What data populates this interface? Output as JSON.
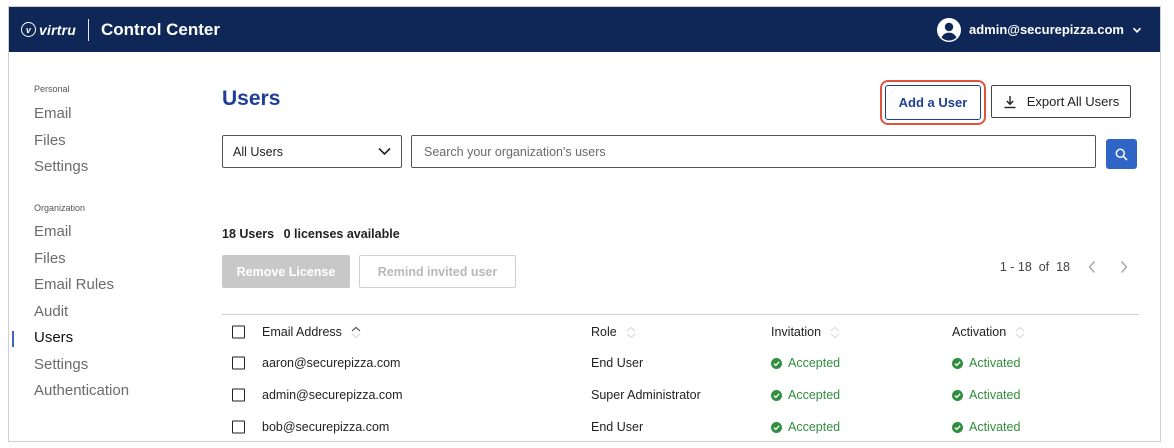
{
  "header": {
    "brand": "virtru",
    "brand_initial": "v",
    "title": "Control Center",
    "account_email": "admin@securepizza.com"
  },
  "sidebar": {
    "personal_label": "Personal",
    "personal_items": [
      "Email",
      "Files",
      "Settings"
    ],
    "organization_label": "Organization",
    "organization_items": [
      "Email",
      "Files",
      "Email Rules",
      "Audit",
      "Users",
      "Settings",
      "Authentication"
    ],
    "active_item": "Users"
  },
  "main": {
    "title": "Users",
    "add_user_label": "Add a User",
    "export_label": "Export All Users",
    "filter_value": "All Users",
    "search_placeholder": "Search your organization's users",
    "user_count": "18 Users",
    "licenses": "0 licenses available",
    "remove_license_label": "Remove License",
    "remind_label": "Remind invited user",
    "pagination": "1 - 18  of  18"
  },
  "table": {
    "columns": [
      "Email Address",
      "Role",
      "Invitation",
      "Activation"
    ],
    "rows": [
      {
        "email": "aaron@securepizza.com",
        "role": "End User",
        "invitation": "Accepted",
        "activation": "Activated"
      },
      {
        "email": "admin@securepizza.com",
        "role": "Super Administrator",
        "invitation": "Accepted",
        "activation": "Activated"
      },
      {
        "email": "bob@securepizza.com",
        "role": "End User",
        "invitation": "Accepted",
        "activation": "Activated"
      }
    ]
  },
  "colors": {
    "header_bg": "#0e2756",
    "primary": "#1d3f95",
    "highlight_outline": "#e0543f",
    "status_ok": "#2f8f3e"
  },
  "icons": {
    "account": "user-circle-icon",
    "dropdown": "chevron-down-icon",
    "export": "download-icon",
    "search": "search-icon",
    "sort": "sort-icon",
    "status": "check-circle-icon",
    "prev": "chevron-left-icon",
    "next": "chevron-right-icon"
  }
}
